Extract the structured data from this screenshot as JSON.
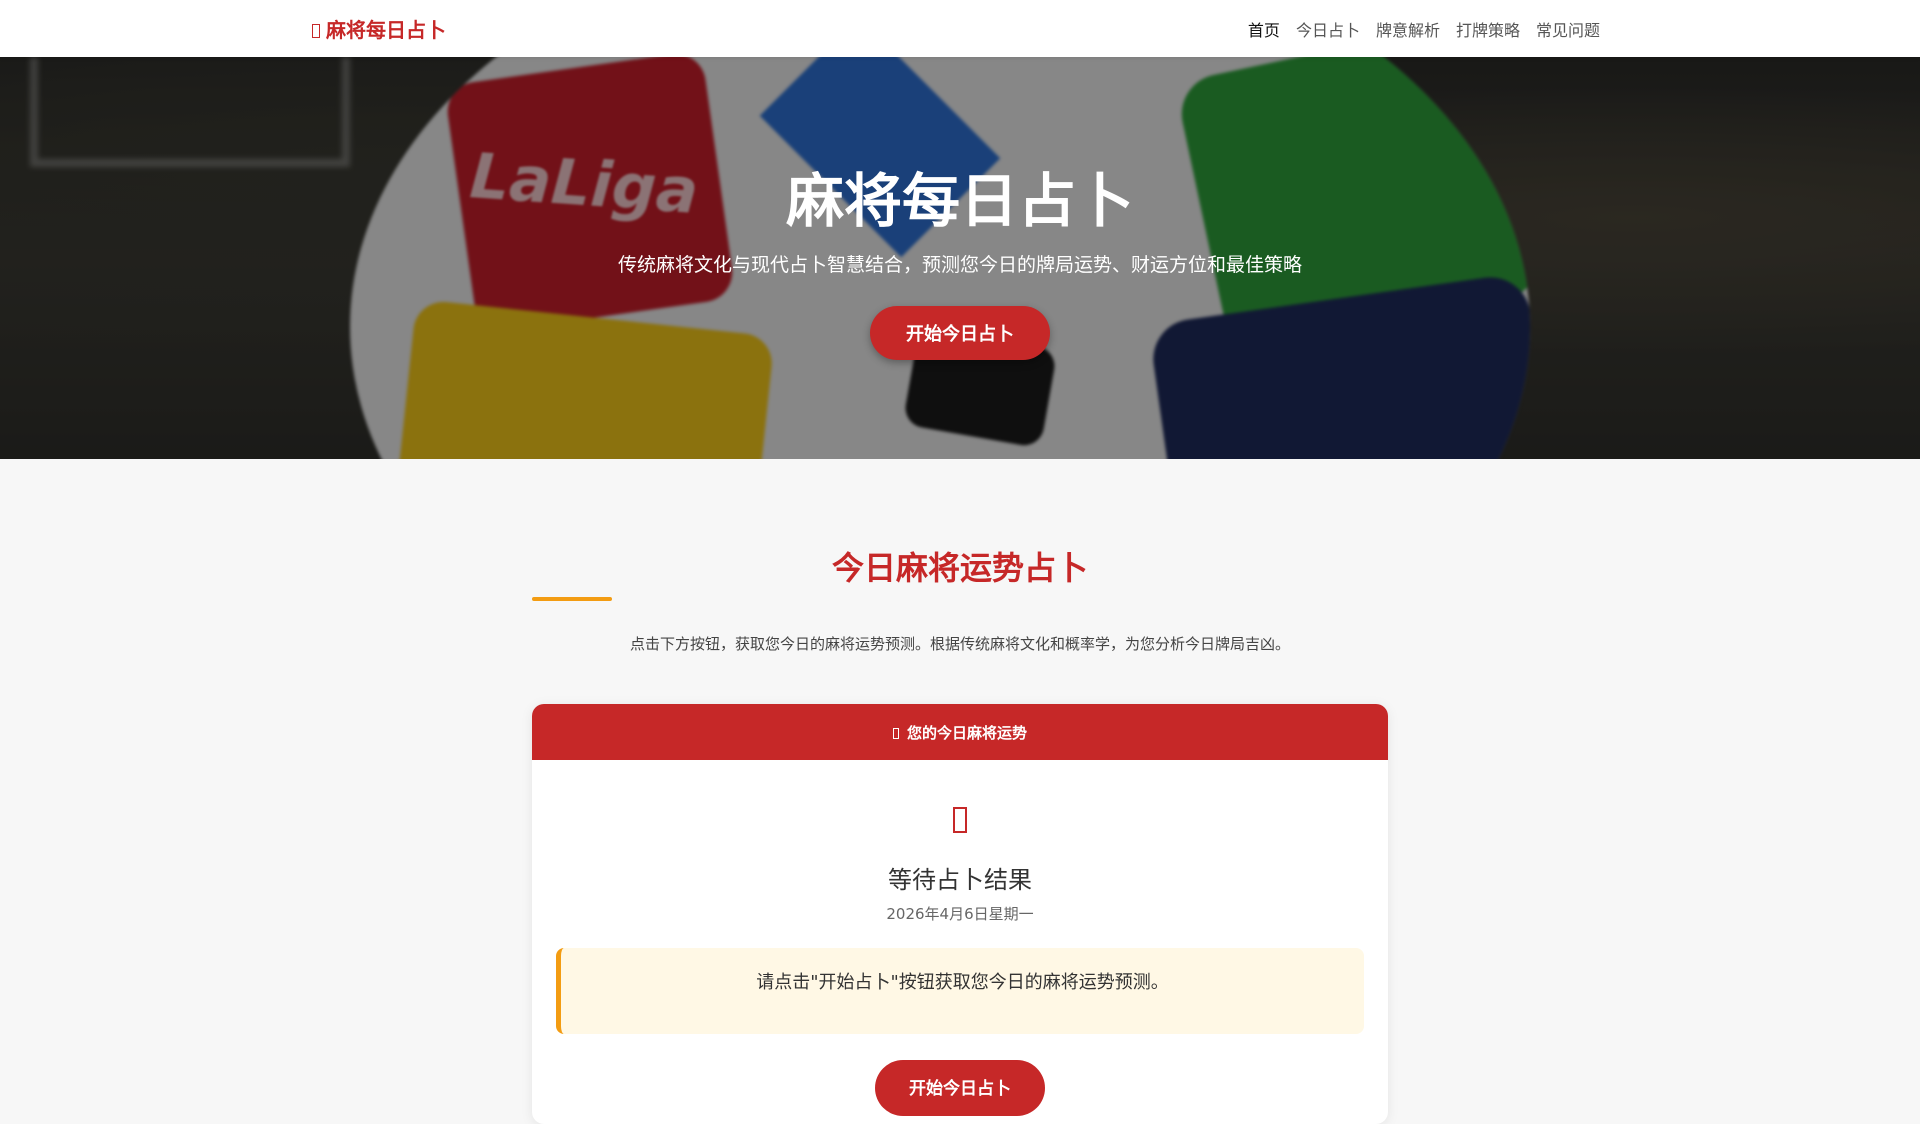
{
  "navbar": {
    "brand": "麻将每日占卜",
    "links": [
      "首页",
      "今日占卜",
      "牌意解析",
      "打牌策略",
      "常见问题"
    ],
    "active_index": 0
  },
  "hero": {
    "title": "麻将每日占卜",
    "subtitle": "传统麻将文化与现代占卜智慧结合，预测您今日的牌局运势、财运方位和最佳策略",
    "button": "开始今日占卜",
    "background_text": "LaLiga"
  },
  "section": {
    "title": "今日麻将运势占卜",
    "description": "点击下方按钮，获取您今日的麻将运势预测。根据传统麻将文化和概率学，为您分析今日牌局吉凶。"
  },
  "card": {
    "header": "您的今日麻将运势",
    "result_title": "等待占卜结果",
    "date": "2026年4月6日星期一",
    "notice": "请点击\"开始占卜\"按钮获取您今日的麻将运势预测。",
    "button": "开始今日占卜"
  },
  "colors": {
    "primary": "#c62828",
    "accent": "#f39c12",
    "notice_bg": "#fff8e5"
  }
}
